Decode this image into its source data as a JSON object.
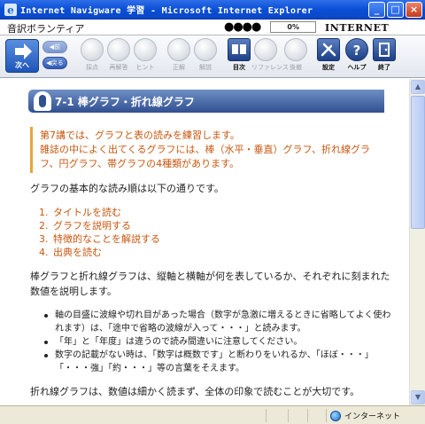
{
  "window": {
    "title": "Internet Navigware 学習 - Microsoft Internet Explorer",
    "minimize": "_",
    "maximize": "□",
    "close": "×"
  },
  "app": {
    "course_title": "音訳ボランティア",
    "progress_dots": "●●●●",
    "progress_percent": "0%",
    "progress_fraction": 0,
    "brand": "INTERNET NAVIGWARE"
  },
  "toolbar": {
    "next": "次へ",
    "prev": "◀前",
    "back": "◀戻る",
    "tools": [
      {
        "label": "採点",
        "enabled": false
      },
      {
        "label": "再解答",
        "enabled": false
      },
      {
        "label": "ヒント",
        "enabled": false
      },
      {
        "label": "正解",
        "enabled": false
      },
      {
        "label": "解説",
        "enabled": false
      },
      {
        "label": "目次",
        "enabled": true
      },
      {
        "label": "リファレンス",
        "enabled": false
      },
      {
        "label": "後撤",
        "enabled": false
      },
      {
        "label": "設定",
        "enabled": true
      },
      {
        "label": "ヘルプ",
        "enabled": true
      },
      {
        "label": "終了",
        "enabled": true
      }
    ]
  },
  "content": {
    "heading": "7-1 棒グラフ・折れ線グラフ",
    "intro_line1": "第7講では、グラフと表の読みを練習します。",
    "intro_line2": "雑誌の中によく出てくるグラフには、棒（水平・垂直）グラフ、折れ線グラフ、円グラフ、帯グラフの4種類があります。",
    "basic_order": "グラフの基本的な読み順は以下の通りです。",
    "steps": [
      {
        "num": "1.",
        "text": "タイトルを読む"
      },
      {
        "num": "2.",
        "text": "グラフを説明する"
      },
      {
        "num": "3.",
        "text": "特徴的なことを解説する"
      },
      {
        "num": "4.",
        "text": "出典を読む"
      }
    ],
    "explain": "棒グラフと折れ線グラフは、縦軸と横軸が何を表しているか、それぞれに刻まれた数値を説明します。",
    "bullets": [
      "軸の目盛に波線や切れ目があった場合（数字が急激に増えるときに省略してよく使われます）は、「途中で省略の波線が入って・・・」と読みます。",
      "「年」と「年度」は違うので読み間違いに注意してください。",
      "数字の記載がない時は、「数字は概数です」と断わりをいれるか、「ほぼ・・・」「・・・強」「約・・・」等の言葉をそえます。"
    ],
    "closing": "折れ線グラフは、数値は細かく読まず、全体の印象で読むことが大切です。"
  },
  "statusbar": {
    "zone": "インターネット"
  },
  "colors": {
    "title_blue": "#0a4fd6",
    "heading_band": "#304f90",
    "accent_orange": "#c9570f"
  }
}
